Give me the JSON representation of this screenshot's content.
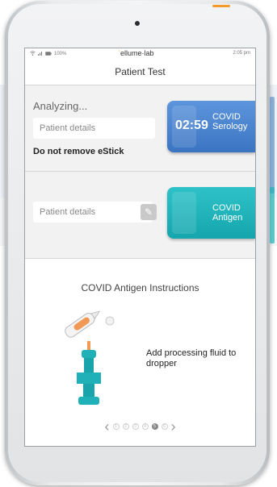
{
  "status_bar": {
    "battery": "100%",
    "brand_prefix": "",
    "brand_mid": "ellume",
    "brand_sep": "·",
    "brand_suffix": "lab",
    "time": "2:05 pm"
  },
  "header": {
    "title": "Patient Test"
  },
  "serology": {
    "status": "Analyzing...",
    "patient_placeholder": "Patient details",
    "warning": "Do not remove eStick",
    "timer": "02:59",
    "label_line1": "COVID",
    "label_line2": "Serology",
    "color": "#4a86d2"
  },
  "antigen": {
    "patient_placeholder": "Patient details",
    "label_line1": "COVID",
    "label_line2": "Antigen",
    "color": "#21b4ba"
  },
  "instructions": {
    "title": "COVID Antigen Instructions",
    "step_text": "Add processing fluid to dropper",
    "pager": {
      "dots": [
        "1",
        "2",
        "3",
        "4",
        "5",
        "6"
      ],
      "current": 5
    }
  },
  "icons": {
    "pencil": "pencil-icon",
    "wifi": "wifi-icon",
    "signal": "signal-icon",
    "battery": "battery-icon",
    "prev": "chevron-left-icon",
    "next": "chevron-right-icon"
  },
  "colors": {
    "accent_orange": "#f39a2b",
    "brand_yellow": "#f0b400"
  }
}
